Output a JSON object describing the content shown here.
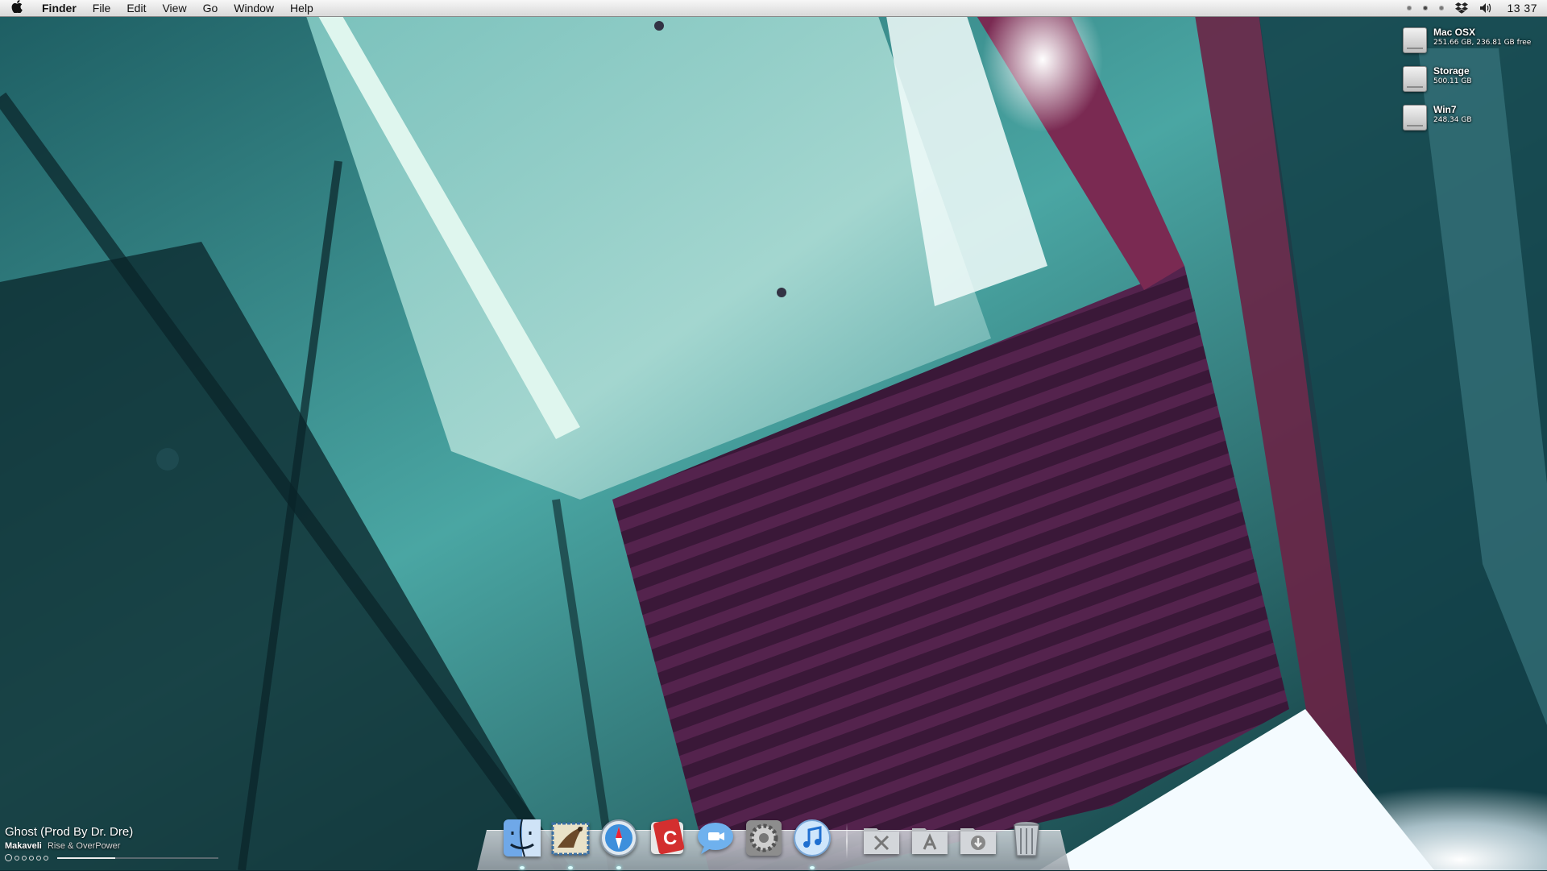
{
  "menubar": {
    "apple_icon": "apple-logo",
    "items": [
      "Finder",
      "File",
      "Edit",
      "View",
      "Go",
      "Window",
      "Help"
    ],
    "status_icons": [
      "dot-icon",
      "dot-icon",
      "dot-icon",
      "dropbox-icon",
      "volume-icon"
    ],
    "clock": "13 37"
  },
  "desktop": {
    "drives": [
      {
        "name": "Mac OSX",
        "info": "251.66 GB, 236.81 GB free"
      },
      {
        "name": "Storage",
        "info": "500.11 GB"
      },
      {
        "name": "Win7",
        "info": "248.34 GB"
      }
    ]
  },
  "now_playing": {
    "song": "Ghost (Prod By Dr. Dre)",
    "artist": "Makaveli",
    "album": "Rise & OverPower",
    "progress": 0.36
  },
  "dock": {
    "apps": [
      {
        "name": "finder-icon",
        "running": true
      },
      {
        "name": "mail-icon",
        "running": true
      },
      {
        "name": "safari-icon",
        "running": true
      },
      {
        "name": "coda-icon",
        "running": false
      },
      {
        "name": "ichat-icon",
        "running": false
      },
      {
        "name": "system-preferences-icon",
        "running": false
      },
      {
        "name": "itunes-icon",
        "running": true
      }
    ],
    "stacks": [
      {
        "name": "utilities-folder-icon"
      },
      {
        "name": "applications-folder-icon"
      },
      {
        "name": "downloads-folder-icon"
      },
      {
        "name": "trash-icon"
      }
    ]
  },
  "colors": {
    "wallpaper_teal": "#3f9a9c",
    "wallpaper_purple": "#3a1838",
    "wallpaper_magenta": "#7a2a52",
    "menubar": "#e8e8e8"
  }
}
